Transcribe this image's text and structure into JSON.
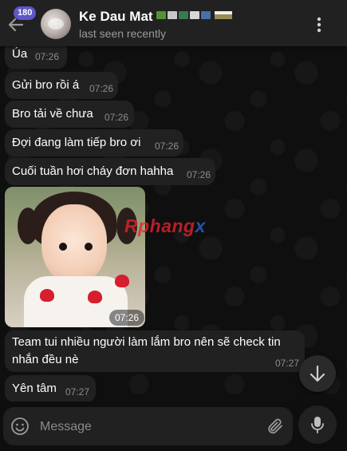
{
  "header": {
    "unread_count": "180",
    "contact_name": "Ke Dau Mat",
    "status": "last seen recently",
    "name_flag_colors": [
      "#5a8f3a",
      "#c8c8c8",
      "#3a7a4f",
      "#d8d8d8",
      "#4a6fa8"
    ]
  },
  "messages": [
    {
      "text": "Úa",
      "time": "07:26"
    },
    {
      "text": "Gửi bro rồi á",
      "time": "07:26"
    },
    {
      "text": "Bro tải về chưa",
      "time": "07:26"
    },
    {
      "text": "Đợi đang làm tiếp bro ơi",
      "time": "07:26"
    },
    {
      "text": "Cuối tuần hơi cháy đơn hahha",
      "time": "07:26"
    },
    {
      "type": "photo",
      "time": "07:26"
    },
    {
      "text_line1": "Team tui nhiều người làm lắm bro nên sẽ check tin",
      "text_line2": "nhắn đều nè",
      "time": "07:27"
    },
    {
      "text": "Yên tâm",
      "time": "07:27"
    }
  ],
  "watermark": {
    "main": "Rphang",
    "accent": "x"
  },
  "composer": {
    "placeholder": "Message"
  },
  "icons": [
    "back-arrow-icon",
    "more-vertical-icon",
    "emoji-icon",
    "paperclip-icon",
    "mic-icon",
    "chevron-down-icon"
  ],
  "colors": {
    "accent": "#5e56c9",
    "bubble": "#212121",
    "header": "#212121",
    "background": "#0e0e0e"
  }
}
